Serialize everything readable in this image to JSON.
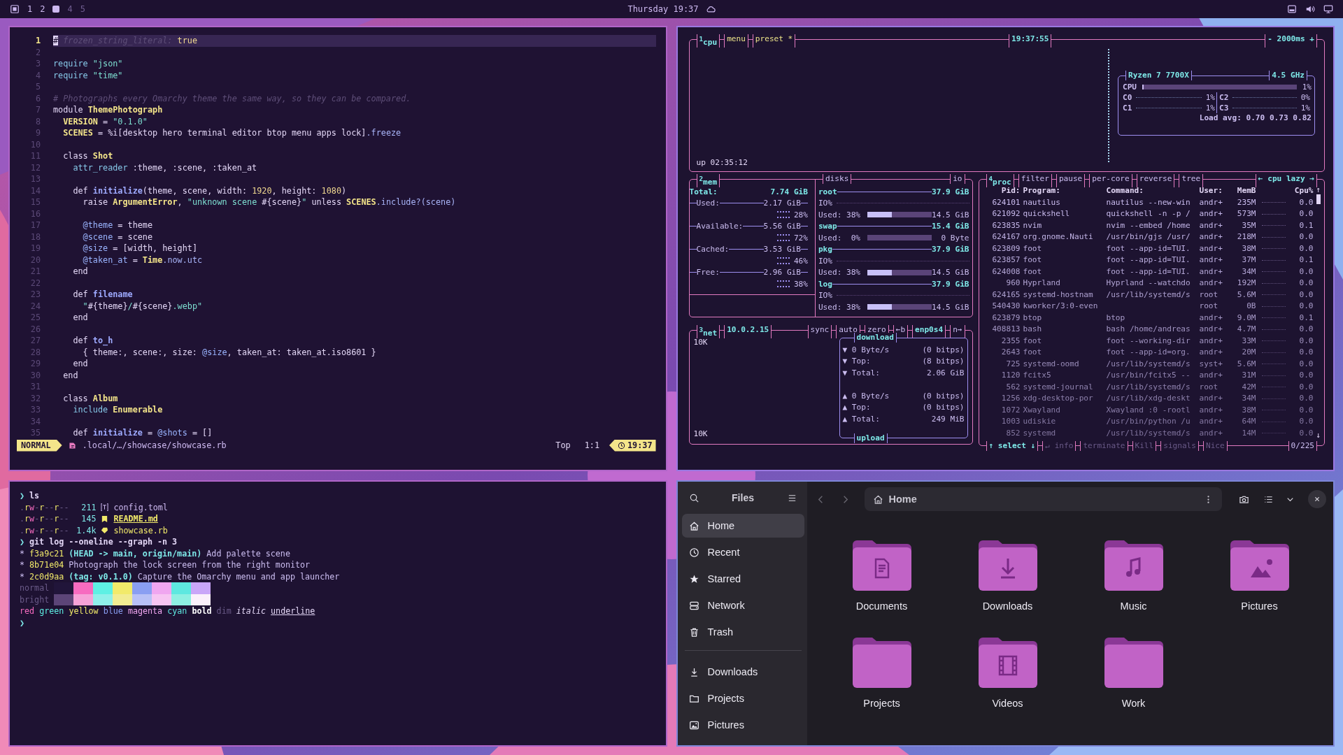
{
  "top_bar": {
    "workspaces": [
      {
        "label": "1",
        "selected": false,
        "occupied": true
      },
      {
        "label": "2",
        "selected": false,
        "occupied": true
      },
      {
        "selected": true
      },
      {
        "label": "4",
        "selected": false,
        "occupied": false
      },
      {
        "label": "5",
        "selected": false,
        "occupied": false
      }
    ],
    "clock": "Thursday 19:37"
  },
  "editor": {
    "lines": [
      {
        "n": "1",
        "current": true,
        "tokens": [
          {
            "text": "#",
            "kind": "cursor"
          },
          {
            "text": " frozen_string_literal:",
            "kind": "comment"
          },
          {
            "text": " true",
            "kind": "num"
          }
        ]
      },
      {
        "n": "2",
        "current": false
      },
      {
        "n": "3",
        "current": false,
        "tokens": [
          {
            "text": "require ",
            "kind": "call"
          },
          {
            "text": "\"json\"",
            "kind": "str"
          }
        ]
      },
      {
        "n": "4",
        "current": false,
        "tokens": [
          {
            "text": "require ",
            "kind": "call"
          },
          {
            "text": "\"time\"",
            "kind": "str"
          }
        ]
      },
      {
        "n": "5",
        "current": false
      },
      {
        "n": "6",
        "current": false,
        "tokens": [
          {
            "text": "# Photographs every Omarchy theme the same way, so they can be compared.",
            "kind": "comment"
          }
        ]
      },
      {
        "n": "7",
        "current": false,
        "tokens": [
          {
            "text": "module ",
            "kind": "kw"
          },
          {
            "text": "ThemePhotograph",
            "kind": "const"
          }
        ]
      },
      {
        "n": "8",
        "current": false,
        "tokens": [
          {
            "text": "  VERSION",
            "kind": "const"
          },
          {
            "text": " = ",
            "kind": "plain"
          },
          {
            "text": "\"0.1.0\"",
            "kind": "str"
          }
        ]
      },
      {
        "n": "9",
        "current": false,
        "tokens": [
          {
            "text": "  SCENES",
            "kind": "const"
          },
          {
            "text": " = %i[desktop hero terminal editor btop menu apps lock]",
            "kind": "plain"
          },
          {
            "text": ".freeze",
            "kind": "method"
          }
        ]
      },
      {
        "n": "10",
        "current": false
      },
      {
        "n": "11",
        "current": false,
        "tokens": [
          {
            "text": "  class ",
            "kind": "kw"
          },
          {
            "text": "Shot",
            "kind": "const"
          }
        ]
      },
      {
        "n": "12",
        "current": false,
        "tokens": [
          {
            "text": "    attr_reader",
            "kind": "call"
          },
          {
            "text": " :theme, :scene, :taken_at",
            "kind": "plain"
          }
        ]
      },
      {
        "n": "13",
        "current": false
      },
      {
        "n": "14",
        "current": false,
        "tokens": [
          {
            "text": "    def ",
            "kind": "kw"
          },
          {
            "text": "initialize",
            "kind": "fn"
          },
          {
            "text": "(theme, scene, width: ",
            "kind": "plain"
          },
          {
            "text": "1920",
            "kind": "num"
          },
          {
            "text": ", height: ",
            "kind": "plain"
          },
          {
            "text": "1080",
            "kind": "num"
          },
          {
            "text": ")",
            "kind": "plain"
          }
        ]
      },
      {
        "n": "15",
        "current": false,
        "tokens": [
          {
            "text": "      raise ",
            "kind": "kw"
          },
          {
            "text": "ArgumentError",
            "kind": "const"
          },
          {
            "text": ", ",
            "kind": "plain"
          },
          {
            "text": "\"unknown scene ",
            "kind": "str"
          },
          {
            "text": "#{scene}",
            "kind": "plain"
          },
          {
            "text": "\"",
            "kind": "str"
          },
          {
            "text": " unless ",
            "kind": "kw"
          },
          {
            "text": "SCENES",
            "kind": "const"
          },
          {
            "text": ".include?(scene)",
            "kind": "method"
          }
        ]
      },
      {
        "n": "16",
        "current": false
      },
      {
        "n": "17",
        "current": false,
        "tokens": [
          {
            "text": "      @theme",
            "kind": "ivar"
          },
          {
            "text": " = theme",
            "kind": "plain"
          }
        ]
      },
      {
        "n": "18",
        "current": false,
        "tokens": [
          {
            "text": "      @scene",
            "kind": "ivar"
          },
          {
            "text": " = scene",
            "kind": "plain"
          }
        ]
      },
      {
        "n": "19",
        "current": false,
        "tokens": [
          {
            "text": "      @size",
            "kind": "ivar"
          },
          {
            "text": " = [width, height]",
            "kind": "plain"
          }
        ]
      },
      {
        "n": "20",
        "current": false,
        "tokens": [
          {
            "text": "      @taken_at",
            "kind": "ivar"
          },
          {
            "text": " = ",
            "kind": "plain"
          },
          {
            "text": "Time",
            "kind": "const"
          },
          {
            "text": ".now.utc",
            "kind": "method"
          }
        ]
      },
      {
        "n": "21",
        "current": false,
        "tokens": [
          {
            "text": "    end",
            "kind": "kw"
          }
        ]
      },
      {
        "n": "22",
        "current": false
      },
      {
        "n": "23",
        "current": false,
        "tokens": [
          {
            "text": "    def ",
            "kind": "kw"
          },
          {
            "text": "filename",
            "kind": "fn"
          }
        ]
      },
      {
        "n": "24",
        "current": false,
        "tokens": [
          {
            "text": "      \"",
            "kind": "str"
          },
          {
            "text": "#{theme}",
            "kind": "plain"
          },
          {
            "text": "/",
            "kind": "str"
          },
          {
            "text": "#{scene}",
            "kind": "plain"
          },
          {
            "text": ".webp\"",
            "kind": "str"
          }
        ]
      },
      {
        "n": "25",
        "current": false,
        "tokens": [
          {
            "text": "    end",
            "kind": "kw"
          }
        ]
      },
      {
        "n": "26",
        "current": false
      },
      {
        "n": "27",
        "current": false,
        "tokens": [
          {
            "text": "    def ",
            "kind": "kw"
          },
          {
            "text": "to_h",
            "kind": "fn"
          }
        ]
      },
      {
        "n": "28",
        "current": false,
        "tokens": [
          {
            "text": "      { theme:, scene:, size: ",
            "kind": "plain"
          },
          {
            "text": "@size",
            "kind": "ivar"
          },
          {
            "text": ", taken_at: taken_at.iso8601 }",
            "kind": "plain"
          }
        ]
      },
      {
        "n": "29",
        "current": false,
        "tokens": [
          {
            "text": "    end",
            "kind": "kw"
          }
        ]
      },
      {
        "n": "30",
        "current": false,
        "tokens": [
          {
            "text": "  end",
            "kind": "kw"
          }
        ]
      },
      {
        "n": "31",
        "current": false
      },
      {
        "n": "32",
        "current": false,
        "tokens": [
          {
            "text": "  class ",
            "kind": "kw"
          },
          {
            "text": "Album",
            "kind": "const"
          }
        ]
      },
      {
        "n": "33",
        "current": false,
        "tokens": [
          {
            "text": "    include ",
            "kind": "call"
          },
          {
            "text": "Enumerable",
            "kind": "const"
          }
        ]
      },
      {
        "n": "34",
        "current": false
      },
      {
        "n": "35",
        "current": false,
        "tokens": [
          {
            "text": "    def ",
            "kind": "kw"
          },
          {
            "text": "initialize",
            "kind": "fn"
          },
          {
            "text": " = ",
            "kind": "plain"
          },
          {
            "text": "@shots",
            "kind": "ivar"
          },
          {
            "text": " = []",
            "kind": "plain"
          }
        ]
      }
    ],
    "status": {
      "mode": "NORMAL",
      "path": ".local/…/showcase/showcase.rb",
      "scroll": "Top",
      "position": "1:1",
      "clock": "19:37"
    }
  },
  "btop": {
    "cpu": {
      "titles_left": [
        {
          "text": "$^{1}$cpu",
          "kind": "cyan"
        },
        {
          "text": "menu",
          "kind": "yellow"
        },
        {
          "text": "preset *",
          "kind": "yellow"
        }
      ],
      "clock": "19:37:55",
      "titles_right": [
        {
          "text": "- 2000ms +",
          "kind": "cyan"
        }
      ],
      "uptime": "up 02:35:12",
      "panel": {
        "titles_left": [
          {
            "text": "Ryzen 7 7700X",
            "kind": "cyan"
          }
        ],
        "titles_right": [
          {
            "text": "4.5 GHz",
            "kind": "cyan"
          }
        ],
        "total": {
          "label": "CPU",
          "level": 0.01,
          "value": "1%"
        },
        "cores": [
          {
            "label": "C0",
            "value": "1%"
          },
          {
            "label": "C2",
            "value": "0%"
          },
          {
            "label": "C1",
            "value": "1%"
          },
          {
            "label": "C3",
            "value": "1%"
          }
        ],
        "load": "Load avg: 0.70 0.73 0.82"
      }
    },
    "mem": {
      "title": {
        "text": "$^{2}$mem",
        "kind": "cyan"
      },
      "rows": [
        {
          "kind": "total",
          "label": "Total:",
          "value": "7.74 GiB"
        },
        {
          "kind": "meter",
          "label": "Used:",
          "value": "2.17 GiB",
          "percent": "28%"
        },
        {
          "kind": "meter",
          "label": "Available:",
          "value": "5.56 GiB",
          "percent": "72%"
        },
        {
          "kind": "meter",
          "label": "Cached:",
          "value": "3.53 GiB",
          "percent": "46%"
        },
        {
          "kind": "meter",
          "label": "Free:",
          "value": "2.96 GiB",
          "percent": "38%"
        }
      ]
    },
    "disks": {
      "titles_left": [
        {
          "text": "disks",
          "kind": "plain"
        }
      ],
      "titles_right": [
        {
          "text": "io",
          "kind": "plain"
        }
      ],
      "items": [
        {
          "name": "root",
          "size": "37.9 GiB",
          "io": "IO%",
          "used": "Used: 38%",
          "level": 0.38,
          "free": "14.5 GiB"
        },
        {
          "name": "swap",
          "size": "15.4 GiB",
          "used": "Used:  0%",
          "level": 0,
          "free": "0 Byte"
        },
        {
          "name": "pkg",
          "size": "37.9 GiB",
          "io": "IO%",
          "used": "Used: 38%",
          "level": 0.38,
          "free": "14.5 GiB"
        },
        {
          "name": "log",
          "size": "37.9 GiB",
          "io": "IO%",
          "used": "Used: 38%",
          "level": 0.38,
          "free": "14.5 GiB"
        }
      ]
    },
    "net": {
      "titles_left": [
        {
          "text": "$^{3}$net",
          "kind": "cyan"
        },
        {
          "text": "10.0.2.15",
          "kind": "cyan"
        }
      ],
      "titles_right": [
        {
          "text": "sync",
          "kind": "plain"
        },
        {
          "text": "auto",
          "kind": "plain"
        },
        {
          "text": "zero",
          "kind": "plain"
        },
        {
          "text": "←b",
          "kind": "plain"
        },
        {
          "text": "enp0s4",
          "kind": "cyan"
        },
        {
          "text": "n→",
          "kind": "plain"
        }
      ],
      "scale_top": "10K",
      "scale_bottom": "10K",
      "download": {
        "title": "download",
        "rows": [
          {
            "label": "▼ 0 Byte/s",
            "value": "(0 bitps)"
          },
          {
            "label": "▼ Top:",
            "value": "(8 bitps)"
          },
          {
            "label": "▼ Total:",
            "value": "2.06 GiB"
          }
        ]
      },
      "upload": {
        "title": "upload",
        "rows": [
          {
            "label": "▲ 0 Byte/s",
            "value": "(0 bitps)"
          },
          {
            "label": "▲ Top:",
            "value": "(0 bitps)"
          },
          {
            "label": "▲ Total:",
            "value": "249 MiB"
          }
        ]
      }
    },
    "proc": {
      "titles_left": [
        {
          "text": "$^{4}$proc",
          "kind": "cyan"
        },
        {
          "text": "filter",
          "kind": "plain"
        },
        {
          "text": "pause",
          "kind": "plain"
        },
        {
          "text": "per-core",
          "kind": "plain"
        },
        {
          "text": "reverse",
          "kind": "plain"
        },
        {
          "text": "tree",
          "kind": "plain"
        }
      ],
      "titles_right": [
        {
          "text": "← cpu lazy →",
          "kind": "cyan"
        }
      ],
      "columns": [
        "Pid:",
        "Program:",
        "Command:",
        "User:",
        "MemB",
        "Cpu%"
      ],
      "scroll_up": "↑",
      "scroll_down": "↓",
      "rows": [
        [
          "624101",
          "nautilus",
          "nautilus --new-win",
          "andr+",
          "235M",
          "0.0"
        ],
        [
          "621092",
          "quickshell",
          "quickshell -n -p /",
          "andr+",
          "573M",
          "0.0"
        ],
        [
          "623835",
          "nvim",
          "nvim --embed /home",
          "andr+",
          "35M",
          "0.1"
        ],
        [
          "624167",
          "org.gnome.Nauti",
          "/usr/bin/gjs /usr/",
          "andr+",
          "218M",
          "0.0"
        ],
        [
          "623809",
          "foot",
          "foot --app-id=TUI.",
          "andr+",
          "38M",
          "0.0"
        ],
        [
          "623857",
          "foot",
          "foot --app-id=TUI.",
          "andr+",
          "37M",
          "0.1"
        ],
        [
          "624008",
          "foot",
          "foot --app-id=TUI.",
          "andr+",
          "34M",
          "0.0"
        ],
        [
          "960",
          "Hyprland",
          "Hyprland --watchdo",
          "andr+",
          "192M",
          "0.0"
        ],
        [
          "624165",
          "systemd-hostnam",
          "/usr/lib/systemd/s",
          "root",
          "5.6M",
          "0.0"
        ],
        [
          "540430",
          "kworker/3:0-even",
          null,
          "root",
          "0B",
          "0.0"
        ],
        [
          "623879",
          "btop",
          "btop",
          "andr+",
          "9.0M",
          "0.1"
        ],
        [
          "408813",
          "bash",
          "bash /home/andreas",
          "andr+",
          "4.7M",
          "0.0"
        ],
        [
          "2355",
          "foot",
          "foot --working-dir",
          "andr+",
          "33M",
          "0.0"
        ],
        [
          "2643",
          "foot",
          "foot --app-id=org.",
          "andr+",
          "20M",
          "0.0"
        ],
        [
          "725",
          "systemd-oomd",
          "/usr/lib/systemd/s",
          "syst+",
          "5.6M",
          "0.0"
        ],
        [
          "1120",
          "fcitx5",
          "/usr/bin/fcitx5 --",
          "andr+",
          "31M",
          "0.0"
        ],
        [
          "562",
          "systemd-journal",
          "/usr/lib/systemd/s",
          "root",
          "42M",
          "0.0"
        ],
        [
          "1256",
          "xdg-desktop-por",
          "/usr/lib/xdg-deskt",
          "andr+",
          "34M",
          "0.0"
        ],
        [
          "1072",
          "Xwayland",
          "Xwayland :0 -rootl",
          "andr+",
          "38M",
          "0.0"
        ],
        [
          "1003",
          "udiskie",
          "/usr/bin/python /u",
          "andr+",
          "64M",
          "0.0"
        ],
        [
          "852",
          "systemd",
          "/usr/lib/systemd/s",
          "andr+",
          "14M",
          "0.0"
        ]
      ],
      "footer_left": [
        {
          "text": "↑ select ↓",
          "kind": "cyan"
        },
        {
          "text": "↵ info",
          "kind": "dim"
        },
        {
          "text": "terminate",
          "kind": "dim"
        },
        {
          "text": "Kill",
          "kind": "dim"
        },
        {
          "text": "signals",
          "kind": "dim"
        },
        {
          "text": "Nice",
          "kind": "dim"
        }
      ],
      "footer_right": [
        {
          "text": "0/225",
          "kind": "plain"
        }
      ]
    }
  },
  "terminal": {
    "lines": [
      {
        "kind": "prompt",
        "symbol": "❯",
        "command": "ls"
      },
      {
        "kind": "listing",
        "files": [
          {
            "kind": "config",
            "perms": ".rw-r--r--",
            "size": "211",
            "name": "config.toml"
          },
          {
            "kind": "readme",
            "perms": ".rw-r--r--",
            "size": "145",
            "name": "README.md"
          },
          {
            "kind": "source",
            "perms": ".rw-r--r--",
            "size": "1.4k",
            "name": "showcase.rb"
          }
        ]
      },
      {
        "kind": "prompt",
        "symbol": "❯",
        "command": "git log --oneline --graph -n 3"
      },
      {
        "kind": "commit",
        "graph": "*",
        "hash": "f3a9c21",
        "refs": "(HEAD -> main, origin/main)",
        "message": "Add palette scene"
      },
      {
        "kind": "commit",
        "graph": "*",
        "hash": "8b71e04",
        "message": "Photograph the lock screen from the right monitor"
      },
      {
        "kind": "commit",
        "graph": "*",
        "hash": "2c0d9aa",
        "refs": "(tag: v0.1.0)",
        "message": "Capture the Omarchy menu and app launcher"
      },
      {
        "kind": "palette",
        "label": "normal",
        "swatches": [
          {
            "color": "#21153a"
          },
          {
            "color": "#f76bc0"
          },
          {
            "color": "#5ef0e4"
          },
          {
            "color": "#f2ea6a"
          },
          {
            "color": "#8a9ef2"
          },
          {
            "color": "#f0a6f0"
          },
          {
            "color": "#5ee8e0"
          },
          {
            "color": "#c9a6f8"
          }
        ]
      },
      {
        "kind": "palette",
        "label": "bright",
        "swatches": [
          {
            "color": "#5c4578"
          },
          {
            "color": "#f6a2d8"
          },
          {
            "color": "#8ff0ea"
          },
          {
            "color": "#f2ec92"
          },
          {
            "color": "#b8c0f6"
          },
          {
            "color": "#f7c4f2"
          },
          {
            "color": "#8ef0e2"
          },
          {
            "color": "#fbf0fb"
          }
        ]
      },
      {
        "kind": "styles",
        "words": [
          {
            "text": "red",
            "kind": "red"
          },
          {
            "text": "green",
            "kind": "green"
          },
          {
            "text": "yellow",
            "kind": "yellow"
          },
          {
            "text": "blue",
            "kind": "blue"
          },
          {
            "text": "magenta",
            "kind": "magenta"
          },
          {
            "text": "cyan",
            "kind": "cyan"
          },
          {
            "text": "bold",
            "kind": "bold"
          },
          {
            "text": "dim",
            "kind": "dim"
          },
          {
            "text": "italic",
            "kind": "italic"
          },
          {
            "text": "underline",
            "kind": "underline"
          }
        ]
      },
      {
        "kind": "prompt",
        "symbol": "❯"
      }
    ]
  },
  "files": {
    "title": "Files",
    "path": "Home",
    "places": [
      {
        "label": "Home",
        "kind": "home",
        "selected": true
      },
      {
        "label": "Recent",
        "kind": "recent",
        "selected": false
      },
      {
        "label": "Starred",
        "kind": "starred",
        "selected": false
      },
      {
        "label": "Network",
        "kind": "network",
        "selected": false
      },
      {
        "label": "Trash",
        "kind": "trash",
        "selected": false
      }
    ],
    "bookmarks": [
      {
        "label": "Downloads",
        "kind": "downloads",
        "selected": false
      },
      {
        "label": "Projects",
        "kind": "folder",
        "selected": false
      },
      {
        "label": "Pictures",
        "kind": "pictures",
        "selected": false
      }
    ],
    "folders": [
      {
        "name": "Documents",
        "kind": "documents"
      },
      {
        "name": "Downloads",
        "kind": "downloads"
      },
      {
        "name": "Music",
        "kind": "music"
      },
      {
        "name": "Pictures",
        "kind": "pictures"
      },
      {
        "name": "Projects",
        "kind": "plain"
      },
      {
        "name": "Videos",
        "kind": "videos"
      },
      {
        "name": "Work",
        "kind": "plain"
      }
    ]
  }
}
